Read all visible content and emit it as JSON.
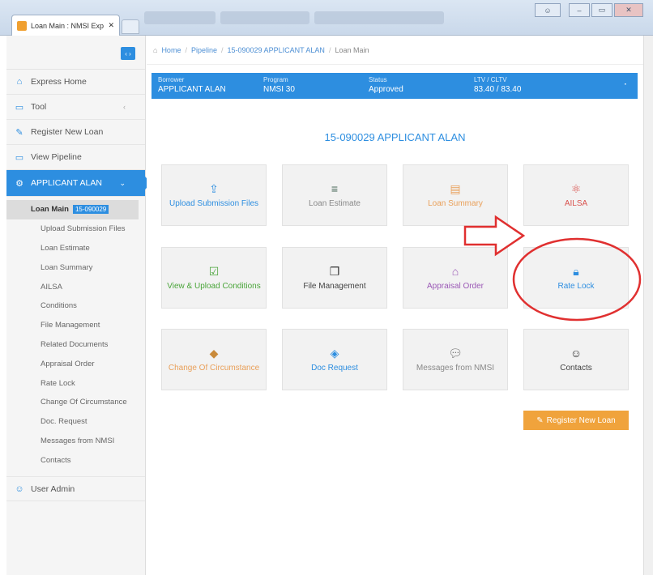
{
  "browser": {
    "tab_title": "Loan Main : NMSI Expre",
    "tab_close": "✕"
  },
  "sidebar": {
    "items": [
      {
        "label": "Express Home",
        "icon": "home-icon"
      },
      {
        "label": "Tool",
        "icon": "tool-icon"
      },
      {
        "label": "Register New Loan",
        "icon": "register-icon"
      },
      {
        "label": "View Pipeline",
        "icon": "monitor-icon"
      }
    ],
    "active_item": {
      "label": "APPLICANT ALAN",
      "icon": "gear-icon"
    },
    "sub_current": {
      "label": "Loan Main",
      "num": "15-090029"
    },
    "sub_items": [
      "Upload Submission Files",
      "Loan Estimate",
      "Loan Summary",
      "AILSA",
      "Conditions",
      "File Management",
      "Related Documents",
      "Appraisal Order",
      "Rate Lock",
      "Change Of Circumstance",
      "Doc. Request",
      "Messages from NMSI",
      "Contacts"
    ],
    "user_admin": "User Admin"
  },
  "breadcrumb": {
    "home": "Home",
    "pipeline": "Pipeline",
    "loan": "15-090029 APPLICANT ALAN",
    "current": "Loan Main"
  },
  "info_bar": {
    "borrower_label": "Borrower",
    "borrower_value": "APPLICANT ALAN",
    "program_label": "Program",
    "program_value": "NMSI 30",
    "status_label": "Status",
    "status_value": "Approved",
    "ltv_label": "LTV / CLTV",
    "ltv_value": "83.40 / 83.40"
  },
  "page_title": "15-090029 APPLICANT ALAN",
  "tiles": [
    {
      "label": "Upload Submission Files",
      "icon": "upload-icon",
      "color": "#2d8ee0"
    },
    {
      "label": "Loan Estimate",
      "icon": "server-icon",
      "color": "#888888"
    },
    {
      "label": "Loan Summary",
      "icon": "document-icon",
      "color": "#e9a05a"
    },
    {
      "label": "AILSA",
      "icon": "atom-icon",
      "color": "#d9534f"
    },
    {
      "label": "View & Upload Conditions",
      "icon": "checkbox-icon",
      "color": "#4aa53a"
    },
    {
      "label": "File Management",
      "icon": "files-icon",
      "color": "#444444"
    },
    {
      "label": "Appraisal Order",
      "icon": "house-icon",
      "color": "#9b59b6"
    },
    {
      "label": "Rate Lock",
      "icon": "lock-icon",
      "color": "#2d8ee0"
    },
    {
      "label": "Change Of Circumstance",
      "icon": "tag-icon",
      "color": "#e9a05a"
    },
    {
      "label": "Doc Request",
      "icon": "layers-icon",
      "color": "#2d8ee0"
    },
    {
      "label": "Messages from NMSI",
      "icon": "chat-icon",
      "color": "#888888"
    },
    {
      "label": "Contacts",
      "icon": "contacts-icon",
      "color": "#444444"
    }
  ],
  "register_button": "Register New Loan",
  "colors": {
    "primary": "#2d8ee0",
    "accent": "#f0a33c",
    "annotation": "#e03030"
  }
}
